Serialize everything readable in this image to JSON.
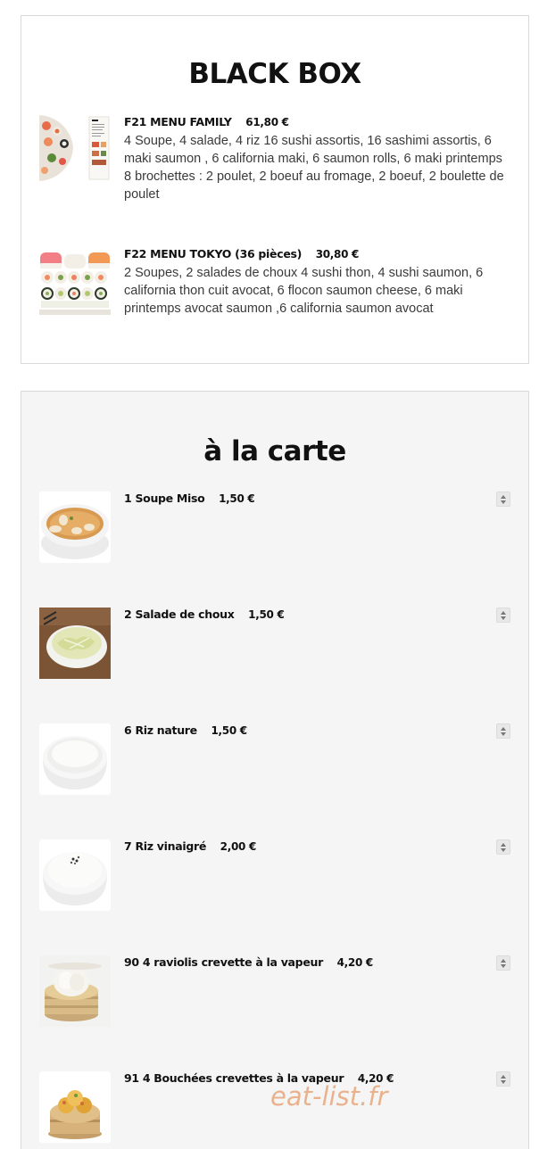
{
  "black_box": {
    "title": "BLACK BOX",
    "items": [
      {
        "name": "F21 MENU FAMILY",
        "price": "61,80 €",
        "description": "4 Soupe, 4 salade, 4 riz 16 sushi assortis, 16 sashimi assortis, 6 maki saumon , 6 california maki, 6 saumon rolls, 6 maki printemps 8 brochettes : 2 poulet, 2 boeuf au fromage, 2 boeuf, 2 boulette de poulet",
        "image_icon": "sushi-platter-menu-image"
      },
      {
        "name": "F22 MENU TOKYO (36 pièces)",
        "price": "30,80 €",
        "description": "2 Soupes, 2 salades de choux 4 sushi thon, 4 sushi saumon, 6 california thon cuit avocat, 6 flocon saumon cheese, 6 maki printemps avocat saumon ,6 california saumon avocat",
        "image_icon": "sushi-rolls-image"
      }
    ]
  },
  "a_la_carte": {
    "title": "à la carte",
    "items": [
      {
        "name": "1 Soupe Miso",
        "price": "1,50 €",
        "image_icon": "miso-soup-image"
      },
      {
        "name": "2 Salade de choux",
        "price": "1,50 €",
        "image_icon": "cabbage-salad-image"
      },
      {
        "name": "6 Riz nature",
        "price": "1,50 €",
        "image_icon": "plain-rice-image"
      },
      {
        "name": "7 Riz vinaigré",
        "price": "2,00 €",
        "image_icon": "vinegar-rice-image"
      },
      {
        "name": "90 4 raviolis crevette à la vapeur",
        "price": "4,20 €",
        "image_icon": "shrimp-dumplings-image"
      },
      {
        "name": "91 4 Bouchées crevettes à la vapeur",
        "price": "4,20 €",
        "image_icon": "shrimp-bouchees-image"
      }
    ]
  },
  "watermark": "eat-list.fr",
  "colors": {
    "panel_border": "#d9d9d9",
    "carte_bg": "#f5f5f5",
    "watermark": "#e8a77b"
  }
}
